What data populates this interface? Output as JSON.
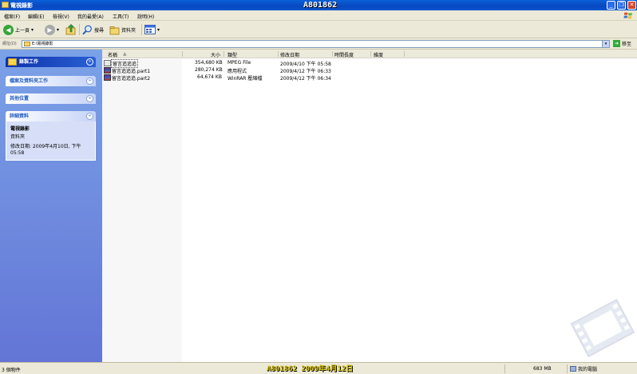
{
  "window": {
    "title": "電視錄影",
    "watermark": "A801862"
  },
  "menu": {
    "items": [
      "檔案(F)",
      "編輯(E)",
      "檢視(V)",
      "我的最愛(A)",
      "工具(T)",
      "說明(H)"
    ]
  },
  "toolbar": {
    "back_label": "上一頁",
    "search_label": "搜尋",
    "folders_label": "資料夾"
  },
  "address": {
    "label": "網址(D)",
    "value": "E:\\電視錄影",
    "go_label": "移至"
  },
  "taskpane": {
    "record_tasks": "錄製工作",
    "file_folder_tasks": "檔案及資料夾工作",
    "other_places": "其他位置",
    "details": {
      "heading": "詳細資料",
      "name": "電視錄影",
      "type": "資料夾",
      "modified": "修改日期: 2009年4月10日, 下午 05:58"
    }
  },
  "columns": {
    "name": "名稱",
    "size": "大小",
    "type": "類型",
    "modified": "修改日期",
    "duration": "時間長度",
    "dimensions": "維度"
  },
  "files": [
    {
      "name": "留言追追追",
      "size": "354,680 KB",
      "type": "MPEG File",
      "modified": "2009/4/10 下午 05:58",
      "icon": "mpeg-icon"
    },
    {
      "name": "留言追追追.part1",
      "size": "280,274 KB",
      "type": "應用程式",
      "modified": "2009/4/12 下午 06:33",
      "icon": "rar-icon"
    },
    {
      "name": "留言追追追.part2",
      "size": "64,674 KB",
      "type": "WinRAR 壓縮檔",
      "modified": "2009/4/12 下午 06:34",
      "icon": "rar-icon"
    }
  ],
  "status": {
    "count": "3 個物件",
    "watermark": "A801862 2009年4月12日",
    "size": "683 MB",
    "location": "我的電腦"
  }
}
